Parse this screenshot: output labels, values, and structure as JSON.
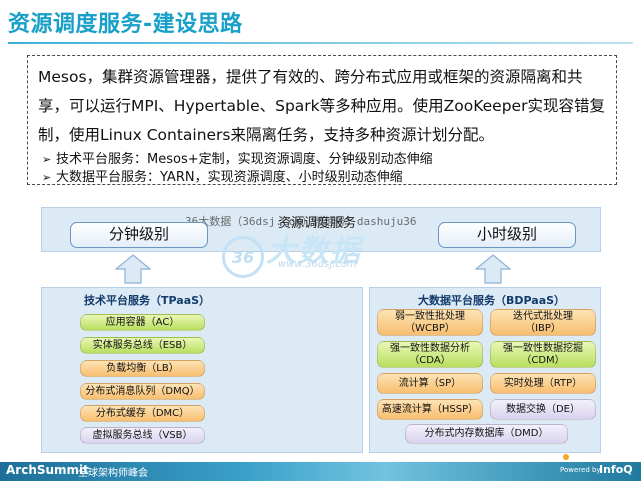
{
  "slide": {
    "title": "资源调度服务-建设思路",
    "intro": "Mesos，集群资源管理器，提供了有效的、跨分布式应用或框架的资源隔离和共享，可以运行MPI、Hypertable、Spark等多种应用。使用ZooKeeper实现容错复制，使用Linux Containers来隔离任务，支持多种资源计划分配。",
    "bullets": [
      "技术平台服务：Mesos+定制，实现资源调度、分钟级别动态伸缩",
      "大数据平台服务：YARN，实现资源调度、小时级别动态伸缩"
    ],
    "bullet_marker": "➢"
  },
  "diagram": {
    "top_label": "资源调度服务",
    "watermark": "36大数据（36dsj.com）微信号：dashuju36",
    "level_minute": "分钟级别",
    "level_hour": "小时级别",
    "tech_panel": {
      "title": "技术平台服务（TPaaS）",
      "items": [
        "应用容器（AC）",
        "实体服务总线（ESB）",
        "负载均衡（LB）",
        "分布式消息队列（DMQ）",
        "分布式缓存（DMC）",
        "虚拟服务总线（VSB）"
      ]
    },
    "bigdata_panel": {
      "title": "大数据平台服务（BDPaaS）",
      "items": [
        {
          "line1": "弱一致性批处理",
          "line2": "（WCBP）"
        },
        {
          "line1": "迭代式批处理",
          "line2": "（IBP）"
        },
        {
          "line1": "强一致性数据分析",
          "line2": "（CDA）"
        },
        {
          "line1": "强一致性数据挖掘",
          "line2": "（CDM）"
        },
        {
          "line1": "流计算（SP）",
          "line2": ""
        },
        {
          "line1": "实时处理（RTP）",
          "line2": ""
        },
        {
          "line1": "高速流计算（HSSP）",
          "line2": ""
        },
        {
          "line1": "数据交换（DE）",
          "line2": ""
        }
      ],
      "wide_item": "分布式内存数据库（DMD）"
    }
  },
  "logo": {
    "circle_text": "36",
    "cn_text": "大数据",
    "url": "www.36dsj.com"
  },
  "footer": {
    "brand": "ArchSummit",
    "subtitle": "全球架构师峰会",
    "powered": "Powered by",
    "infoq": "InfoQ"
  },
  "colors": {
    "title": "#18a0c8",
    "panel": "#dceaf6",
    "chip_green": "#b8df5f",
    "chip_orange": "#f8be70",
    "chip_lavender": "#d9d3ee"
  }
}
